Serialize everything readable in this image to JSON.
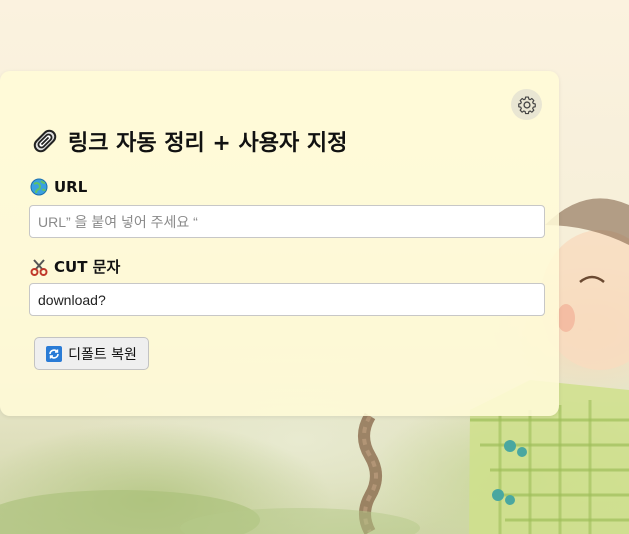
{
  "header": {
    "title": "링크 자동 정리 + 사용자 지정",
    "title_icon": "paperclip-icon",
    "settings_icon": "gear-icon"
  },
  "url_field": {
    "label": "URL",
    "label_icon": "globe-icon",
    "value": "",
    "placeholder": "URL” 을 붙여 넣어 주세요 “"
  },
  "cut_field": {
    "label": "CUT 문자",
    "label_icon": "scissors-icon",
    "value": "download?",
    "placeholder": ""
  },
  "restore_button": {
    "label": "디폴트 복원",
    "icon": "refresh-icon"
  },
  "colors": {
    "panel": "#fffad7",
    "refresh_icon_bg": "#2a7bd6"
  }
}
